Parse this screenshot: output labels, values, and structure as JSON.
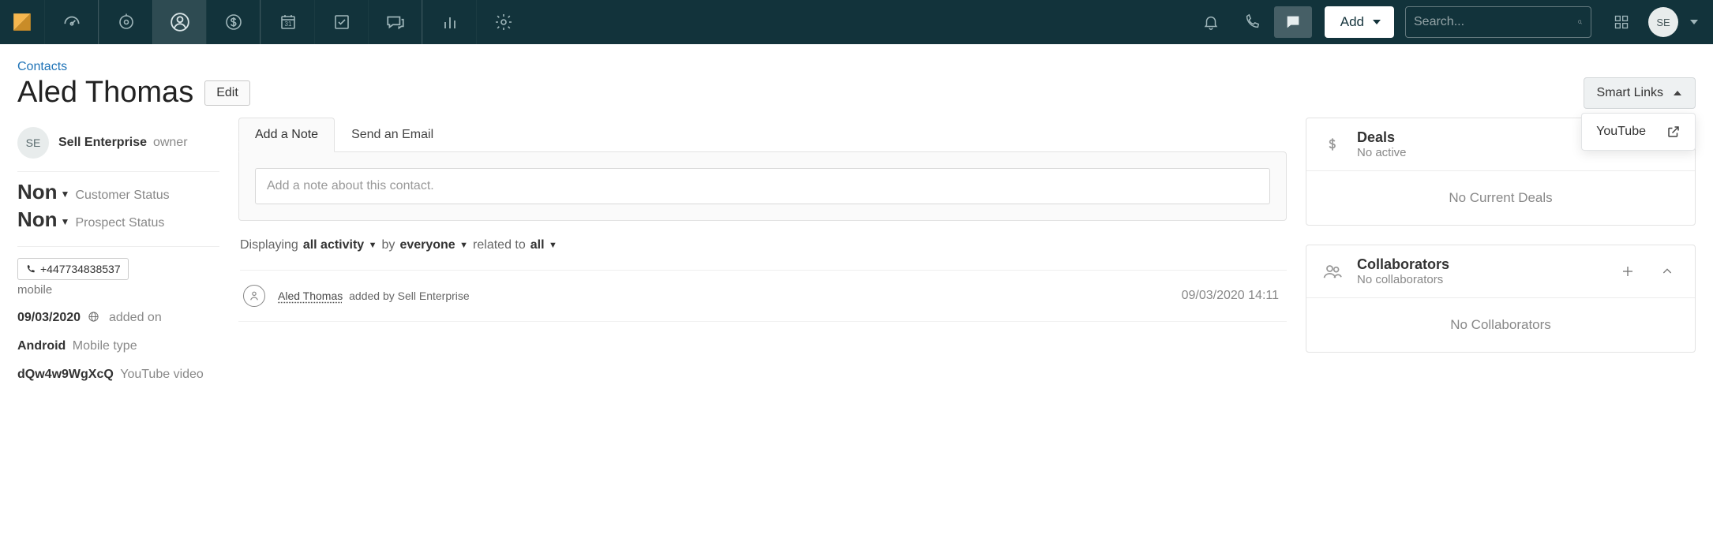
{
  "nav": {
    "add_label": "Add",
    "search_placeholder": "Search...",
    "avatar_initials": "SE"
  },
  "breadcrumb": "Contacts",
  "contact_name": "Aled Thomas",
  "edit_label": "Edit",
  "smart_links_label": "Smart Links",
  "smart_links_item": "YouTube",
  "owner": {
    "initials": "SE",
    "name": "Sell Enterprise",
    "role": "owner"
  },
  "customer_status": {
    "value": "Non",
    "label": "Customer Status"
  },
  "prospect_status": {
    "value": "Non",
    "label": "Prospect Status"
  },
  "phone": {
    "number": "+447734838537",
    "type": "mobile"
  },
  "meta": {
    "added_date": "09/03/2020",
    "added_label": "added on",
    "mobile_type": "Android",
    "mobile_type_label": "Mobile type",
    "youtube_id": "dQw4w9WgXcQ",
    "youtube_label": "YouTube video"
  },
  "tabs": {
    "note": "Add a Note",
    "email": "Send an Email"
  },
  "note_placeholder": "Add a note about this contact.",
  "filter": {
    "pre": "Displaying",
    "activity": "all activity",
    "by_pre": "by",
    "by": "everyone",
    "rel_pre": "related to",
    "rel": "all"
  },
  "feed": {
    "who": "Aled Thomas",
    "rest": "added by Sell Enterprise",
    "time": "09/03/2020 14:11"
  },
  "deals": {
    "title": "Deals",
    "subtitle": "No active",
    "empty": "No Current Deals"
  },
  "collab": {
    "title": "Collaborators",
    "subtitle": "No collaborators",
    "empty": "No Collaborators"
  }
}
